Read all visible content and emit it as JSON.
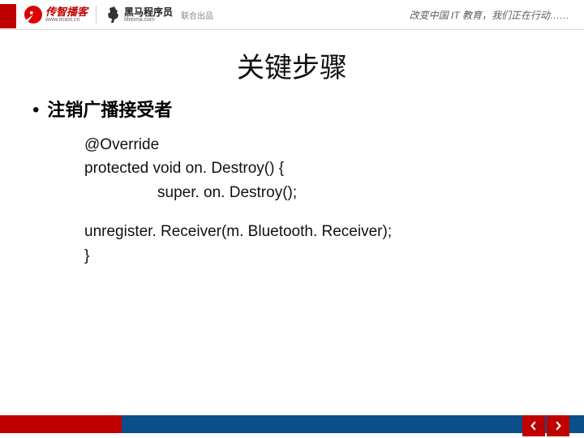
{
  "header": {
    "logo1_name": "传智播客",
    "logo1_url": "www.itcast.cn",
    "logo2_name": "黑马程序员",
    "logo2_url": "itheima.com",
    "joint_label": "联合出品",
    "tagline": "改变中国 IT 教育，我们正在行动……"
  },
  "title": "关键步骤",
  "bullet": {
    "marker": "•",
    "text": "注销广播接受者"
  },
  "code": {
    "line1": "@Override",
    "line2": "protected void on. Destroy() {",
    "line3": "super. on. Destroy();",
    "line4": "unregister. Receiver(m. Bluetooth. Receiver);",
    "line5": "}"
  },
  "nav": {
    "prev_icon": "chevron-left",
    "next_icon": "chevron-right"
  }
}
